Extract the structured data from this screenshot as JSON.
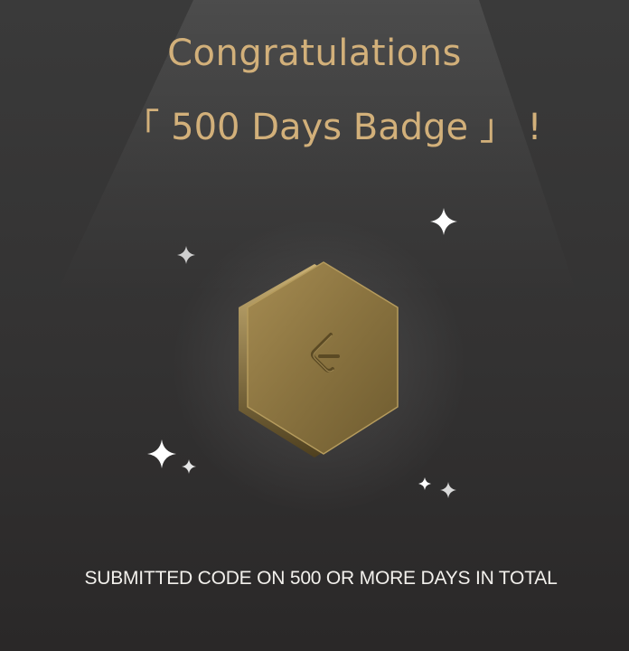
{
  "header": {
    "title_line1": "Congratulations",
    "title_line2": "「 500 Days Badge 」 !"
  },
  "badge": {
    "icon": "leetcode-logo-icon",
    "colors": {
      "face": "#8e7743",
      "face_light": "#b39a5c",
      "face_dark": "#5e4d27",
      "edge": "#4e3f1f"
    }
  },
  "sparkles": {
    "icon": "sparkle-icon",
    "color": "#ffffff"
  },
  "caption": {
    "text": "SUBMITTED CODE ON 500 OR MORE DAYS IN TOTAL"
  },
  "colors": {
    "title": "#d2b07a",
    "caption": "#f2f0ec",
    "background": "#333232"
  }
}
